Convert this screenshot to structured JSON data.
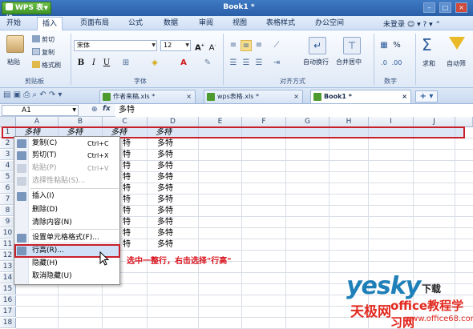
{
  "app": {
    "app_button": "WPS 表格",
    "window_title": "Book1 *"
  },
  "menu": {
    "tabs": [
      "开始",
      "插入",
      "页面布局",
      "公式",
      "数据",
      "审阅",
      "视图",
      "表格样式",
      "办公空间"
    ],
    "active": "开始",
    "login": "未登录"
  },
  "ribbon": {
    "clipboard": {
      "paste": "粘贴",
      "cut": "剪切",
      "copy": "复制",
      "format_painter": "格式刷",
      "label": "剪贴板"
    },
    "font": {
      "name": "宋体",
      "size": "12",
      "label": "字体",
      "bold": "B",
      "italic": "I",
      "underline": "U"
    },
    "alignment": {
      "label": "对齐方式",
      "wrap": "自动换行",
      "merge": "合并居中"
    },
    "number": {
      "label": "数字",
      "percent": "%"
    },
    "sum": "求和",
    "filter": "自动筛"
  },
  "doc_tabs": [
    {
      "label": "作者来稿.xls *",
      "active": false
    },
    {
      "label": "wps表格.xls *",
      "active": false
    },
    {
      "label": "Book1 *",
      "active": true
    }
  ],
  "formula_bar": {
    "cell_ref": "A1",
    "fx": "fx",
    "value": "多特"
  },
  "grid": {
    "columns": [
      "A",
      "B",
      "C",
      "D",
      "E",
      "F",
      "G",
      "H",
      "I",
      "J"
    ],
    "rows": [
      "1",
      "2",
      "3",
      "4",
      "5",
      "6",
      "7",
      "8",
      "9",
      "10",
      "11",
      "12",
      "13",
      "14",
      "15",
      "16",
      "17",
      "18"
    ],
    "row1": [
      "多特",
      "多特",
      "多特",
      "多特"
    ],
    "d_values": [
      "多特",
      "多特",
      "多特",
      "多特",
      "多特",
      "多特",
      "多特",
      "多特",
      "多特",
      "多特"
    ],
    "c_partial": [
      "特",
      "特",
      "特",
      "特",
      "特",
      "特",
      "特",
      "特",
      "特",
      "特"
    ]
  },
  "context_menu": {
    "items": [
      {
        "label": "复制(C)",
        "shortcut": "Ctrl+C",
        "disabled": false
      },
      {
        "label": "剪切(T)",
        "shortcut": "Ctrl+X",
        "disabled": false
      },
      {
        "label": "粘贴(P)",
        "shortcut": "Ctrl+V",
        "disabled": true
      },
      {
        "label": "选择性粘贴(S)...",
        "shortcut": "",
        "disabled": true
      },
      {
        "label": "插入(I)",
        "shortcut": "",
        "disabled": false
      },
      {
        "label": "删除(D)",
        "shortcut": "",
        "disabled": false
      },
      {
        "label": "清除内容(N)",
        "shortcut": "",
        "disabled": false
      },
      {
        "label": "设置单元格格式(F)...",
        "shortcut": "",
        "disabled": false
      },
      {
        "label": "行高(R)...",
        "shortcut": "",
        "disabled": false
      },
      {
        "label": "隐藏(H)",
        "shortcut": "",
        "disabled": false
      },
      {
        "label": "取消隐藏(U)",
        "shortcut": "",
        "disabled": false
      }
    ]
  },
  "annotation": "选中一整行，右击选择\"行高\"",
  "watermark": {
    "brand": "yesky",
    "tagline": "下载",
    "cn": "天极网",
    "site_cn": "office教程学习网",
    "url": "www.office68.com"
  },
  "colors": {
    "title_bar": "#2a5fa8",
    "highlight": "#c8202a",
    "app_button": "#3f9626"
  }
}
